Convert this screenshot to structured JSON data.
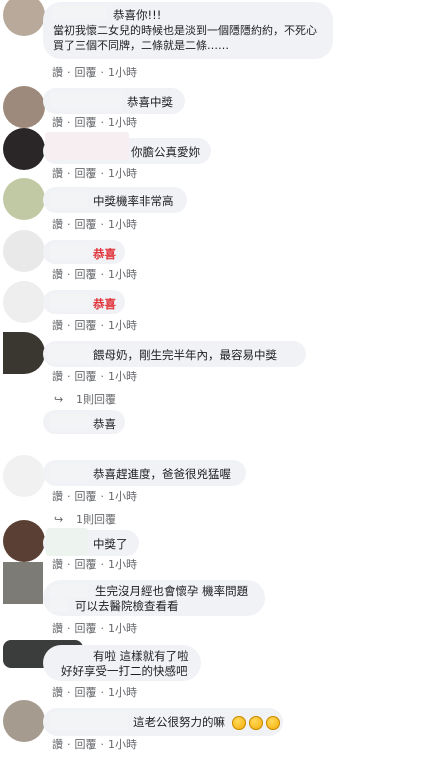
{
  "actions": {
    "like": "讚",
    "reply": "回覆",
    "sep": "·"
  },
  "comments": [
    {
      "text": "恭喜你!!!\n當初我懷二女兒的時候也是淡到一個隱隱約約，不死心買了三個不同牌，二條就是二條……",
      "time": "1小時"
    },
    {
      "text": "恭喜中獎",
      "time": "1小時"
    },
    {
      "text": "你膽公真愛妳",
      "time": "1小時"
    },
    {
      "text": "中獎機率非常高",
      "time": "1小時"
    },
    {
      "text": "恭喜",
      "time": "1小時"
    },
    {
      "text": "恭喜",
      "time": "1小時"
    },
    {
      "text": "餵母奶，剛生完半年內，最容易中獎",
      "time": "1小時",
      "reply_label": "1則回覆"
    },
    {
      "text": "恭喜",
      "time": ""
    },
    {
      "text": "恭喜趕進度，爸爸很兇猛喔",
      "time": "1小時",
      "reply_label": "1則回覆"
    },
    {
      "text": "中獎了",
      "time": "1小時"
    },
    {
      "text": "生完沒月經也會懷孕 機率問題\n可以去醫院檢查看看",
      "time": "1小時"
    },
    {
      "text": "有啦 這樣就有了啦\n好好享受一打二的快感吧",
      "time": "1小時"
    },
    {
      "text": "這老公很努力的嘛",
      "time": "1小時",
      "emoji": [
        "laughing-face-icon",
        "laughing-face-icon",
        "laughing-face-icon"
      ]
    }
  ]
}
